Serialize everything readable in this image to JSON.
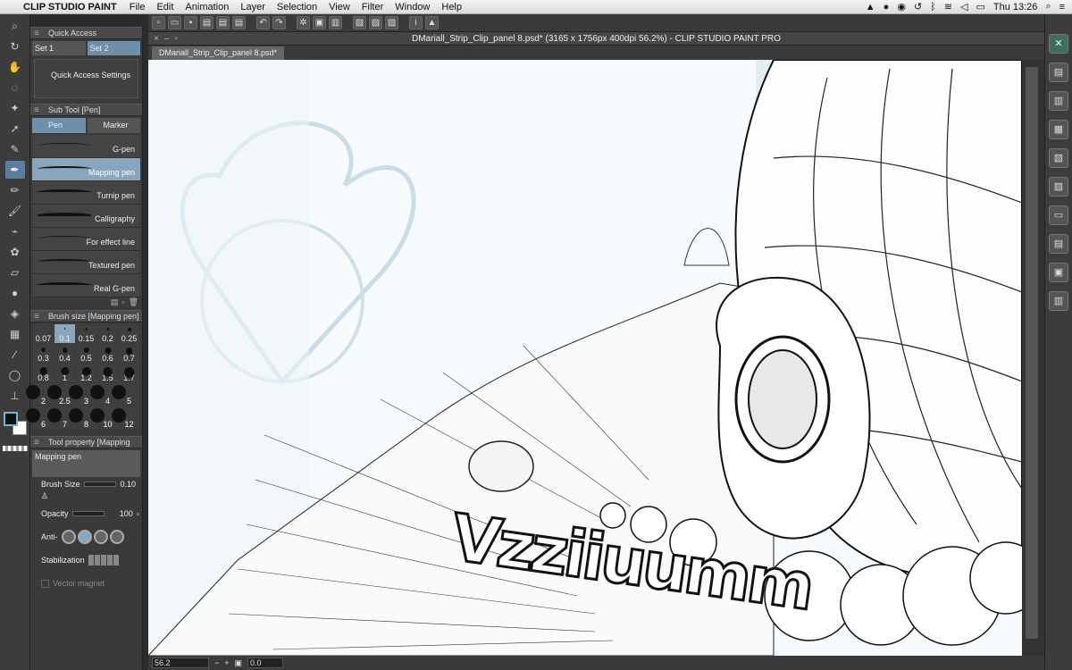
{
  "menubar": {
    "app_name": "CLIP STUDIO PAINT",
    "menus": [
      "File",
      "Edit",
      "Animation",
      "Layer",
      "Selection",
      "View",
      "Filter",
      "Window",
      "Help"
    ],
    "clock": "Thu 13:26"
  },
  "window": {
    "title": "DMariall_Strip_Clip_panel 8.psd* (3165 x 1756px 400dpi 56.2%)  - CLIP STUDIO PAINT PRO",
    "doc_tab": "DMariall_Strip_Clip_panel 8.psd*"
  },
  "quick_access": {
    "title": "Quick Access",
    "tabs": [
      "Set 1",
      "Set 2"
    ],
    "selected_tab": "Set 2",
    "settings_label": "Quick Access Settings"
  },
  "sub_tool": {
    "title": "Sub Tool [Pen]",
    "groups": [
      "Pen",
      "Marker"
    ],
    "brushes": [
      "G-pen",
      "Mapping pen",
      "Turnip pen",
      "Calligraphy",
      "For effect line",
      "Textured pen",
      "Real G-pen"
    ],
    "selected": "Mapping pen"
  },
  "brush_size": {
    "title": "Brush size [Mapping pen]",
    "sizes": [
      "0.07",
      "0.1",
      "0.15",
      "0.2",
      "0.25",
      "0.3",
      "0.4",
      "0.5",
      "0.6",
      "0.7",
      "0.8",
      "1",
      "1.2",
      "1.5",
      "1.7",
      "2",
      "2.5",
      "3",
      "4",
      "5",
      "6",
      "7",
      "8",
      "10",
      "12"
    ],
    "selected": "0.1"
  },
  "tool_property": {
    "title": "Tool property [Mapping",
    "subtool_name": "Mapping pen",
    "brush_size_label": "Brush Size",
    "brush_size_value": "0.10",
    "opacity_label": "Opacity",
    "opacity_value": "100",
    "anti_label": "Anti-",
    "stabilization_label": "Stabilization",
    "vector_magnet_label": "Vector magnet"
  },
  "status": {
    "zoom": "56.2",
    "rotation": "0.0"
  },
  "artwork": {
    "sfx_text": "Vzziiuumm"
  },
  "colors": {
    "ui_dark": "#3a3a3a",
    "selection": "#8aa6bc",
    "main_color": "#111111",
    "sub_color": "#ffffff"
  }
}
